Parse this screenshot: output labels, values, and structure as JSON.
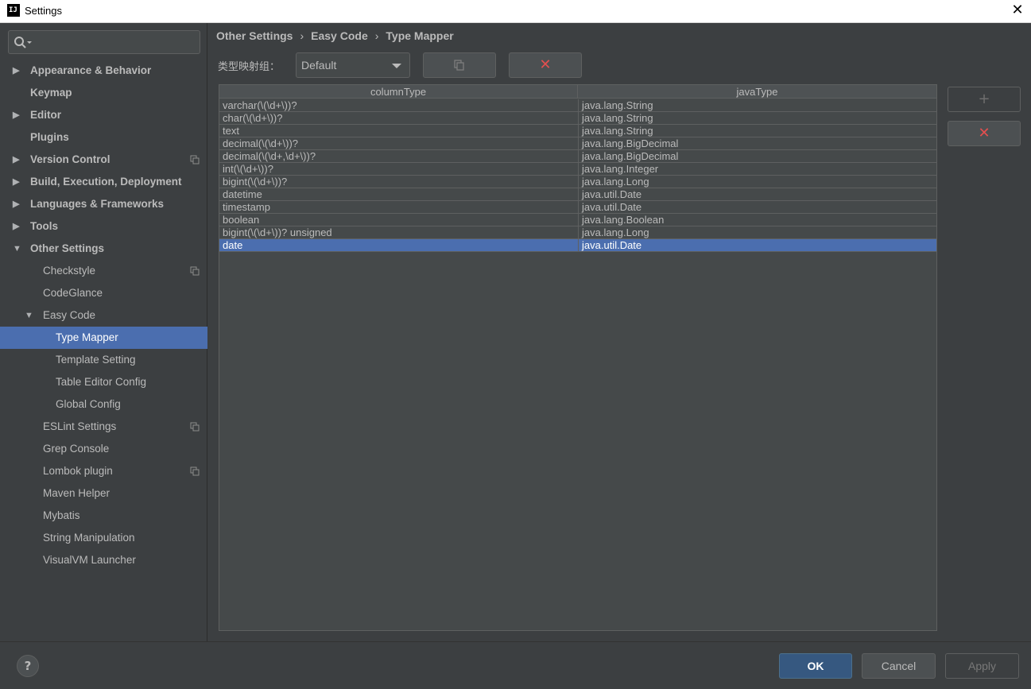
{
  "window": {
    "title": "Settings",
    "app_icon": "intellij-icon",
    "close_glyph": "✕"
  },
  "search": {
    "value": "",
    "icon": "search-icon"
  },
  "sidebar": {
    "items": [
      {
        "label": "Appearance & Behavior",
        "level": 0,
        "expandable": true,
        "expanded": false,
        "bold": true,
        "project_icon": false
      },
      {
        "label": "Keymap",
        "level": 0,
        "expandable": false,
        "bold": true,
        "project_icon": false
      },
      {
        "label": "Editor",
        "level": 0,
        "expandable": true,
        "expanded": false,
        "bold": true,
        "project_icon": false
      },
      {
        "label": "Plugins",
        "level": 0,
        "expandable": false,
        "bold": true,
        "project_icon": false
      },
      {
        "label": "Version Control",
        "level": 0,
        "expandable": true,
        "expanded": false,
        "bold": true,
        "project_icon": true
      },
      {
        "label": "Build, Execution, Deployment",
        "level": 0,
        "expandable": true,
        "expanded": false,
        "bold": true,
        "project_icon": false
      },
      {
        "label": "Languages & Frameworks",
        "level": 0,
        "expandable": true,
        "expanded": false,
        "bold": true,
        "project_icon": false
      },
      {
        "label": "Tools",
        "level": 0,
        "expandable": true,
        "expanded": false,
        "bold": true,
        "project_icon": false
      },
      {
        "label": "Other Settings",
        "level": 0,
        "expandable": true,
        "expanded": true,
        "bold": true,
        "project_icon": false
      },
      {
        "label": "Checkstyle",
        "level": 1,
        "expandable": false,
        "project_icon": true
      },
      {
        "label": "CodeGlance",
        "level": 1,
        "expandable": false,
        "project_icon": false
      },
      {
        "label": "Easy Code",
        "level": 1,
        "expandable": true,
        "expanded": true,
        "project_icon": false
      },
      {
        "label": "Type Mapper",
        "level": 2,
        "expandable": false,
        "selected": true,
        "project_icon": false
      },
      {
        "label": "Template Setting",
        "level": 2,
        "expandable": false,
        "project_icon": false
      },
      {
        "label": "Table Editor Config",
        "level": 2,
        "expandable": false,
        "project_icon": false
      },
      {
        "label": "Global Config",
        "level": 2,
        "expandable": false,
        "project_icon": false
      },
      {
        "label": "ESLint Settings",
        "level": 1,
        "expandable": false,
        "project_icon": true
      },
      {
        "label": "Grep Console",
        "level": 1,
        "expandable": false,
        "project_icon": false
      },
      {
        "label": "Lombok plugin",
        "level": 1,
        "expandable": false,
        "project_icon": true
      },
      {
        "label": "Maven Helper",
        "level": 1,
        "expandable": false,
        "project_icon": false
      },
      {
        "label": "Mybatis",
        "level": 1,
        "expandable": false,
        "project_icon": false
      },
      {
        "label": "String Manipulation",
        "level": 1,
        "expandable": false,
        "project_icon": false
      },
      {
        "label": "VisualVM Launcher",
        "level": 1,
        "expandable": false,
        "project_icon": false
      }
    ]
  },
  "breadcrumb": {
    "parts": [
      "Other Settings",
      "Easy Code",
      "Type Mapper"
    ],
    "separator": "›"
  },
  "group": {
    "label": "类型映射组：",
    "selected": "Default"
  },
  "toolbar": {
    "copy_icon": "copy-icon",
    "delete_glyph": "✕"
  },
  "side_buttons": {
    "add_glyph": "+",
    "delete_glyph": "✕"
  },
  "table": {
    "columns": [
      "columnType",
      "javaType"
    ],
    "rows": [
      [
        "varchar(\\(\\d+\\))?",
        "java.lang.String"
      ],
      [
        "char(\\(\\d+\\))?",
        "java.lang.String"
      ],
      [
        "text",
        "java.lang.String"
      ],
      [
        "decimal(\\(\\d+\\))?",
        "java.lang.BigDecimal"
      ],
      [
        "decimal(\\(\\d+,\\d+\\))?",
        "java.lang.BigDecimal"
      ],
      [
        "int(\\(\\d+\\))?",
        "java.lang.Integer"
      ],
      [
        "bigint(\\(\\d+\\))?",
        "java.lang.Long"
      ],
      [
        "datetime",
        "java.util.Date"
      ],
      [
        "timestamp",
        "java.util.Date"
      ],
      [
        "boolean",
        "java.lang.Boolean"
      ],
      [
        "bigint(\\(\\d+\\))? unsigned",
        "java.lang.Long"
      ],
      [
        "date",
        "java.util.Date"
      ]
    ],
    "selected_row": 11
  },
  "footer": {
    "help_glyph": "?",
    "ok": "OK",
    "cancel": "Cancel",
    "apply": "Apply"
  },
  "colors": {
    "background": "#3c3f41",
    "selection": "#4b6eaf",
    "ok_button": "#365880",
    "delete_red": "#e34f4f"
  }
}
